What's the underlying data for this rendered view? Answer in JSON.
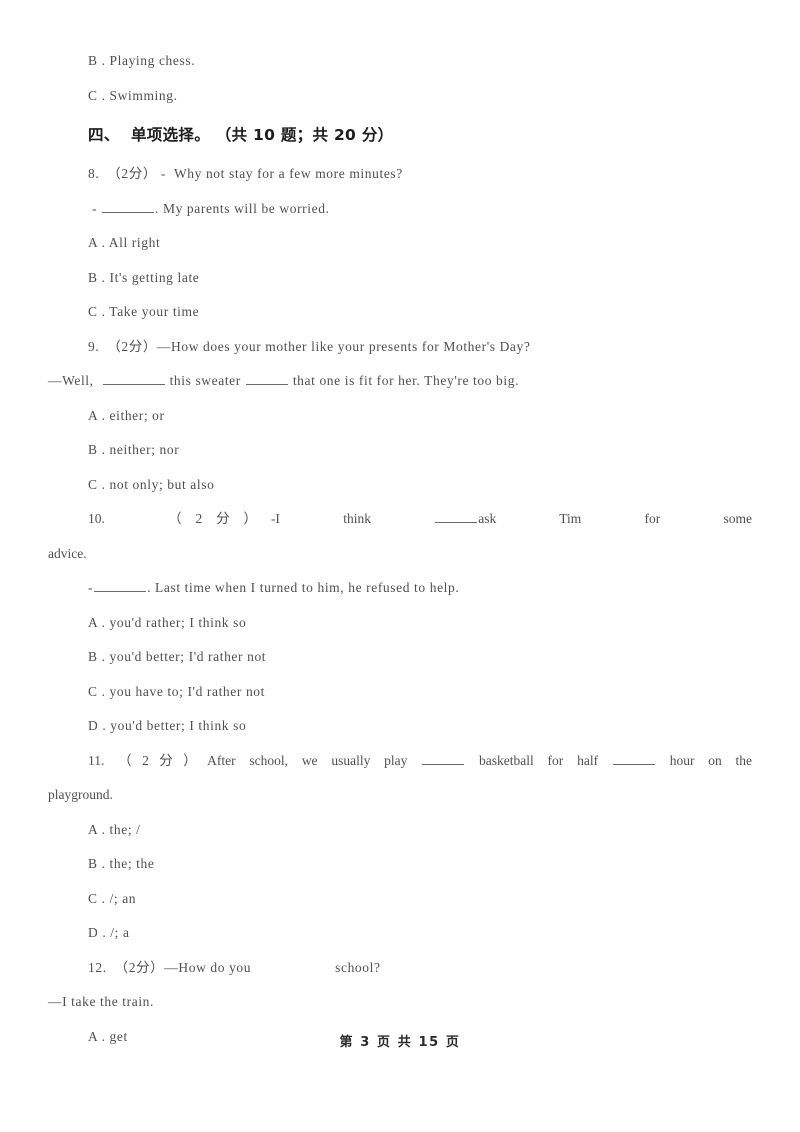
{
  "document": {
    "page_label": "第 3 页 共 15 页",
    "page_number": 3,
    "total_pages": 15,
    "text_color": "#4f4f4f",
    "heading_color": "#1d1d1d",
    "background": "#ffffff"
  },
  "carryover_options": [
    {
      "label": "B . Playing chess."
    },
    {
      "label": "C . Swimming."
    }
  ],
  "section": {
    "heading": "四、  单项选择。 （共 10 题；共 20 分）",
    "number": "四、",
    "title": "单项选择。",
    "meta": "（共 10 题；共 20 分）"
  },
  "questions": [
    {
      "number": "8.",
      "score": "（2分）",
      "stem": "8.  （2分） -  Why not stay for a few more minutes?",
      "continuation": " -  ______. My parents will be worried.",
      "cont_prefix": " - ",
      "cont_suffix": ". My parents will be worried.",
      "options": [
        {
          "label": "A . All right"
        },
        {
          "label": "B . It's getting late"
        },
        {
          "label": "C . Take your time"
        }
      ]
    },
    {
      "number": "9.",
      "score": "（2分）",
      "stem": "9.  （2分）—How does your mother like your presents for Mother's Day?",
      "cont_prefix": "—Well,  ",
      "cont_middle": " this sweater ",
      "cont_suffix": " that one is fit for her. They're too big.",
      "options": [
        {
          "label": "A . either; or"
        },
        {
          "label": "B . neither; nor"
        },
        {
          "label": "C . not only; but also"
        }
      ]
    },
    {
      "number": "10.",
      "score": "（2分）",
      "stem_pre": "10.",
      "stem_score": "（2分）",
      "stem_words": "-I think",
      "stem_after_blank": "ask Tim for some",
      "stem_wrap": "advice.",
      "cont_prefix": "-",
      "cont_suffix": ". Last time when I turned to him, he refused to help.",
      "options": [
        {
          "label": "A . you'd rather; I think so"
        },
        {
          "label": "B . you'd better; I'd rather not"
        },
        {
          "label": "C . you have to; I'd rather not"
        },
        {
          "label": "D . you'd better; I think so"
        }
      ]
    },
    {
      "number": "11.",
      "score": "（2分）",
      "stem_pre": "11.  （2分）After school, we usually play",
      "stem_mid": "basketball for half",
      "stem_post": "hour on the",
      "stem_wrap": "playground.",
      "options": [
        {
          "label": "A . the; /"
        },
        {
          "label": "B . the; the"
        },
        {
          "label": "C . /; an"
        },
        {
          "label": "D . /; a"
        }
      ]
    },
    {
      "number": "12.",
      "score": "（2分）",
      "stem_pre": "12.  （2分）—How do you",
      "stem_post": "school?",
      "continuation": "—I take the train.",
      "options": [
        {
          "label": "A . get"
        }
      ]
    }
  ]
}
